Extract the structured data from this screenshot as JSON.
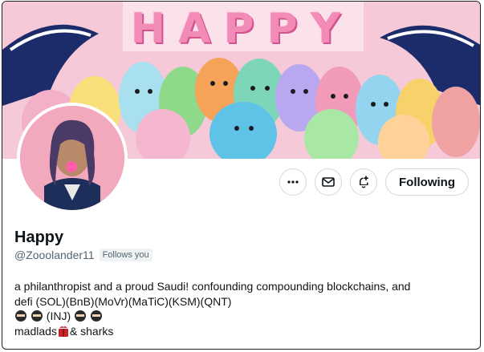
{
  "banner": {
    "title": "HAPPY",
    "colors": {
      "sky": "#f6c9d8",
      "wave": "#1c2c6b",
      "foam": "#ffffff"
    }
  },
  "profile": {
    "name": "Happy",
    "handle": "@Zooolander11",
    "follows_you": "Follows you"
  },
  "actions": {
    "more_icon": "ellipsis-icon",
    "message_icon": "envelope-icon",
    "notify_icon": "bell-plus-icon",
    "following_label": "Following"
  },
  "bio": {
    "line1": "a philanthropist and a proud Saudi! confounding compounding blockchains, and",
    "line2": "defi (SOL)(BnB)(MoVr)(MaTiC)(KSM)(QNT)",
    "line3_text": "(INJ)",
    "line4_pre": "madlads",
    "line4_post": "& sharks"
  }
}
